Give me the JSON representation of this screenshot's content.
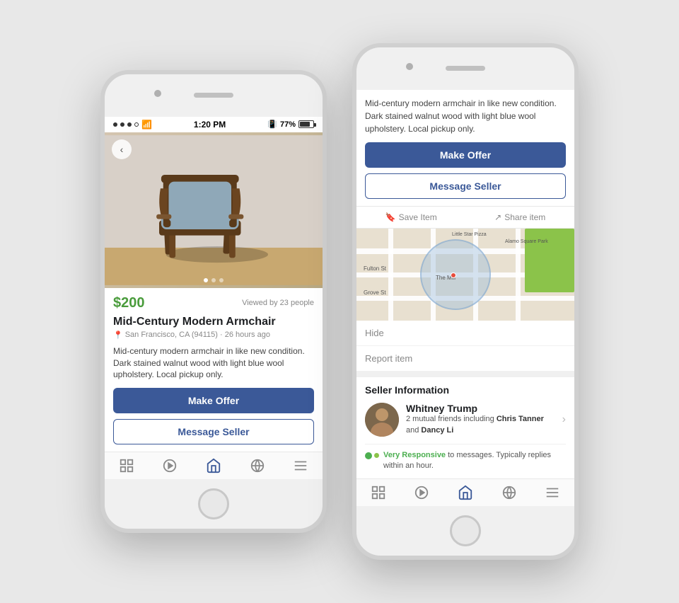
{
  "phone1": {
    "status": {
      "time": "1:20 PM",
      "battery": "77%",
      "bluetooth": "BT"
    },
    "listing": {
      "price": "$200",
      "viewed": "Viewed by 23 people",
      "title": "Mid-Century Modern Armchair",
      "location": "San Francisco, CA (94115) · 26 hours ago",
      "description": "Mid-century modern armchair in like new condition. Dark stained walnut wood with light blue wool upholstery. Local pickup only.",
      "make_offer": "Make Offer",
      "message_seller": "Message Seller"
    }
  },
  "phone2": {
    "description": "Mid-century modern armchair in like new condition. Dark stained walnut wood with light blue wool upholstery. Local pickup only.",
    "make_offer": "Make Offer",
    "message_seller": "Message Seller",
    "save_item": "Save Item",
    "share_item": "Share item",
    "hide": "Hide",
    "report_item": "Report item",
    "seller_section_title": "Seller Information",
    "seller": {
      "name": "Whitney Trump",
      "mutual_friends": "2 mutual friends including",
      "friend1": "Chris Tanner",
      "and": "and",
      "friend2": "Dancy Li"
    },
    "responsive": {
      "label": "Very Responsive",
      "text": "to messages. Typically replies within an hour."
    }
  },
  "map": {
    "label_fulton": "Fulton St",
    "label_grove": "Grove St",
    "label_mill": "The Mill",
    "label_alamo": "Alamo Square Park",
    "label_star": "Little Star Pizza"
  },
  "nav": {
    "items": [
      "news-feed",
      "video",
      "marketplace",
      "globe",
      "menu"
    ]
  }
}
